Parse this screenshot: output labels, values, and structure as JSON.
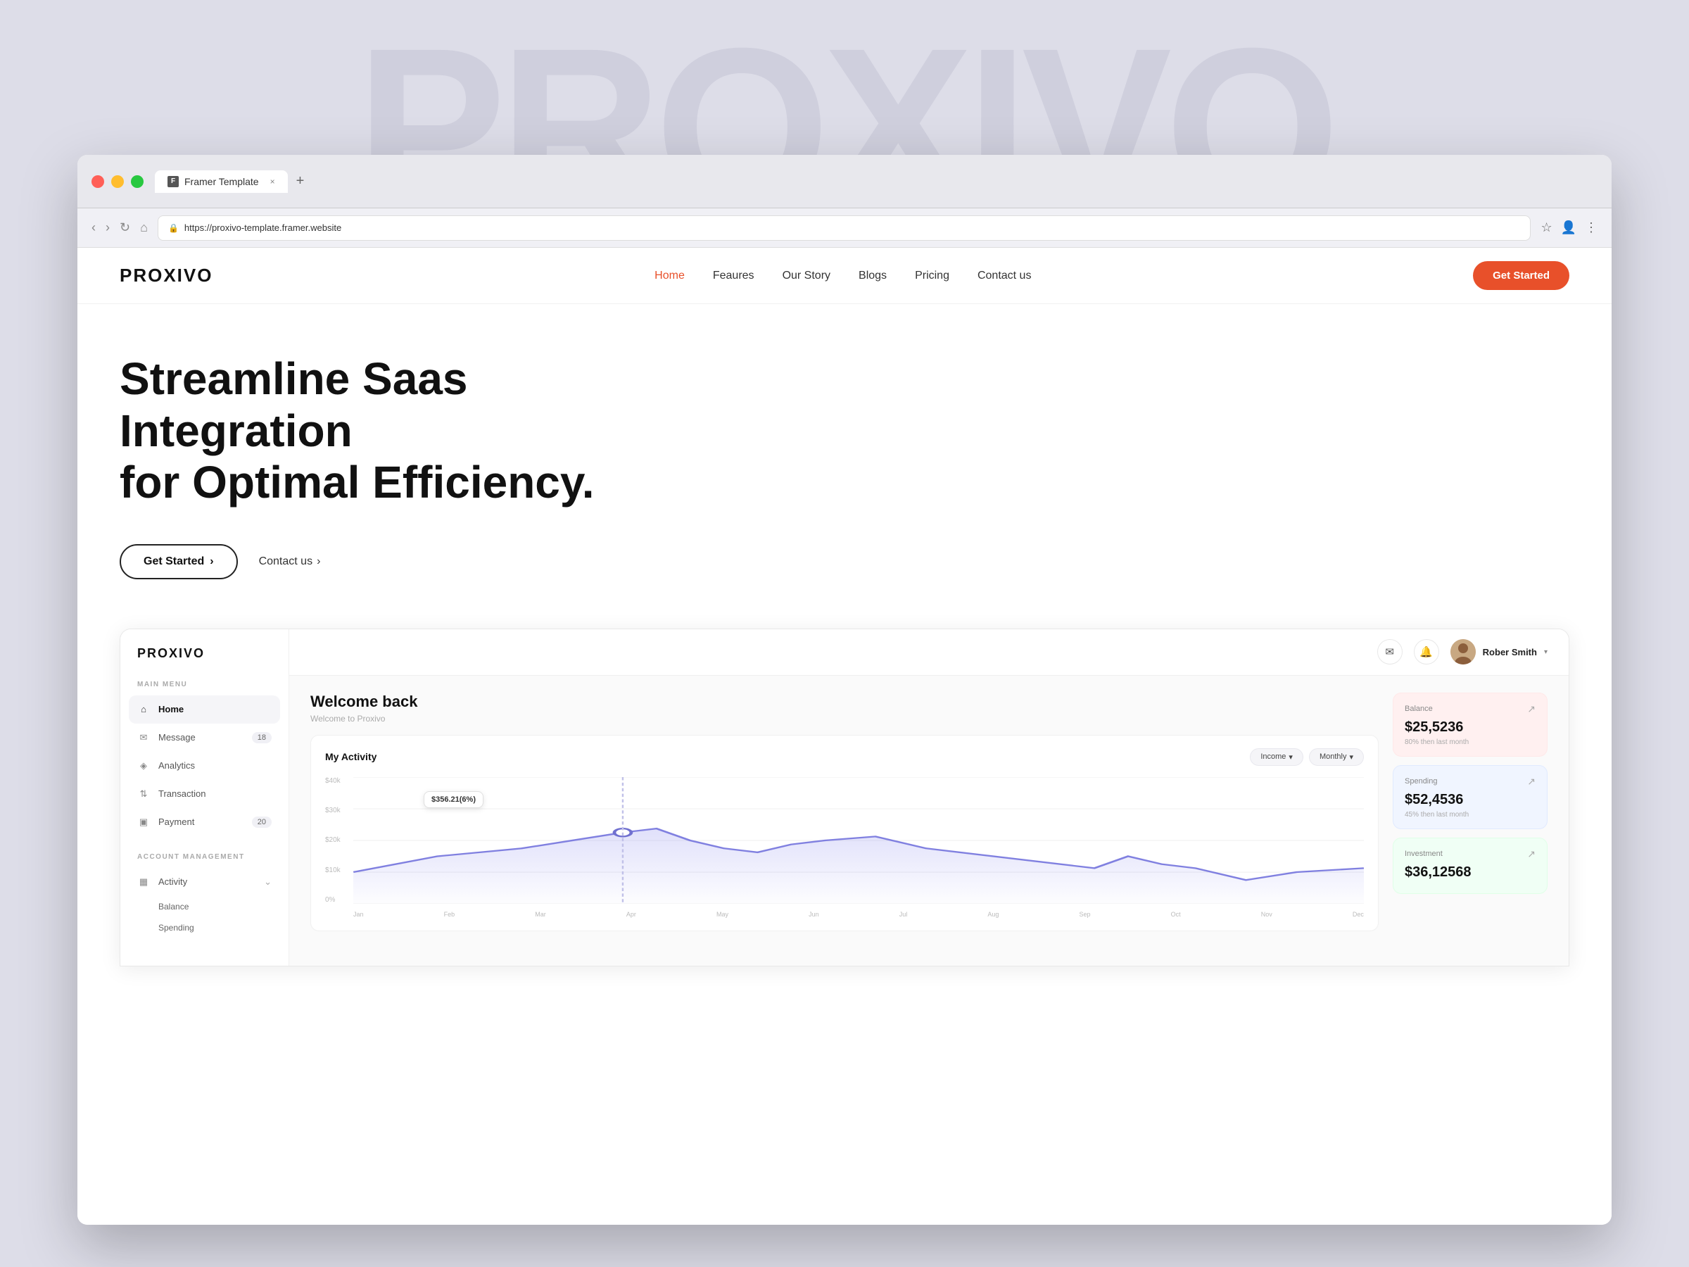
{
  "watermark": "PROXIVO",
  "browser": {
    "tab_label": "Framer Template",
    "tab_close": "×",
    "tab_add": "+",
    "url": "https://proxivo-template.framer.website",
    "nav_back": "‹",
    "nav_forward": "›",
    "nav_refresh": "↻",
    "nav_home": "⌂"
  },
  "site": {
    "logo": "PROXIVO",
    "nav": [
      {
        "label": "Home",
        "active": true
      },
      {
        "label": "Feaures"
      },
      {
        "label": "Our Story"
      },
      {
        "label": "Blogs"
      },
      {
        "label": "Pricing"
      },
      {
        "label": "Contact us"
      }
    ],
    "cta": "Get Started",
    "hero_line1": "Streamline Saas Integration",
    "hero_line2": "for Optimal Efficiency.",
    "btn_get_started": "Get Started",
    "btn_get_started_arrow": "›",
    "btn_contact": "Contact us",
    "btn_contact_arrow": "›"
  },
  "dashboard": {
    "sidebar_logo": "PROXIVO",
    "main_menu_label": "MAIN MENU",
    "account_management_label": "ACCOUNT MANAGEMENT",
    "sidebar_items": [
      {
        "label": "Home",
        "icon": "home",
        "active": true
      },
      {
        "label": "Message",
        "icon": "message",
        "badge": "18"
      },
      {
        "label": "Analytics",
        "icon": "analytics"
      },
      {
        "label": "Transaction",
        "icon": "transaction"
      },
      {
        "label": "Payment",
        "icon": "payment",
        "badge": "20"
      }
    ],
    "account_items": [
      {
        "label": "Activity",
        "icon": "activity",
        "expanded": true
      },
      {
        "sub": [
          "Balance",
          "Spending"
        ]
      }
    ],
    "header_icons": [
      "mail",
      "bell"
    ],
    "user_name": "Rober Smith",
    "welcome_title": "Welcome back",
    "welcome_sub": "Welcome to Proxivo",
    "activity_title": "My Activity",
    "filter_income": "Income",
    "filter_monthly": "Monthly",
    "chart_tooltip": "$356.21(6%)",
    "chart_y": [
      "$40k",
      "$30k",
      "$20k",
      "$10k",
      "0%"
    ],
    "chart_x": [
      "Jan",
      "Feb",
      "Mar",
      "Apr",
      "May",
      "Jun",
      "Jul",
      "Aug",
      "Sep",
      "Oct",
      "Nov",
      "Dec"
    ],
    "stats": [
      {
        "title": "Balance",
        "value": "$25,5236",
        "change": "80% then last month",
        "color": "pink",
        "arrow": "↗"
      },
      {
        "title": "Spending",
        "value": "$52,4536",
        "change": "45% then last month",
        "color": "blue",
        "arrow": "↗"
      },
      {
        "title": "Investment",
        "value": "$36,12568",
        "change": "",
        "color": "green",
        "arrow": "↗"
      }
    ]
  }
}
